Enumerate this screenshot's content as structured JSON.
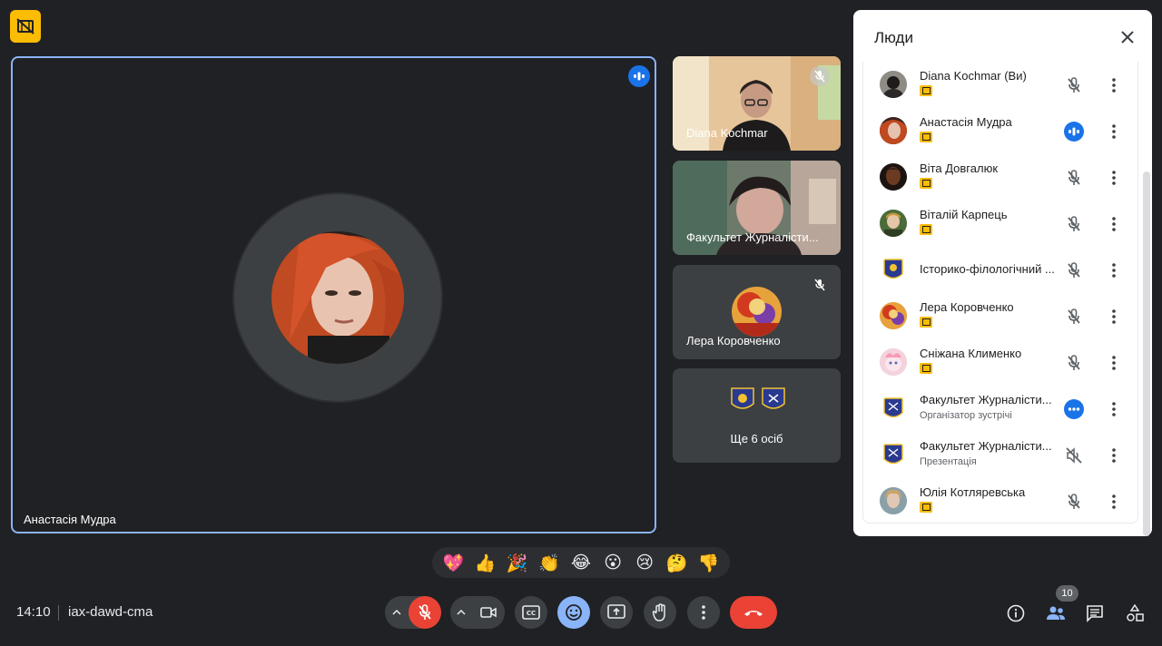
{
  "main": {
    "speaker_name": "Анастасія Мудра"
  },
  "side_tiles": [
    {
      "name": "Diana Kochmar"
    },
    {
      "name": "Факультет Журналісти..."
    },
    {
      "name": "Лера Коровченко"
    },
    {
      "label": "Ще 6 осіб"
    }
  ],
  "people_panel": {
    "title": "Люди",
    "participants": [
      {
        "name": "Diana Kochmar (Ви)",
        "subtitle": "",
        "status": "mic-off"
      },
      {
        "name": "Анастасія Мудра",
        "subtitle": "",
        "status": "speaking"
      },
      {
        "name": "Віта Довгалюк",
        "subtitle": "",
        "status": "mic-off"
      },
      {
        "name": "Віталій Карпець",
        "subtitle": "",
        "status": "mic-off"
      },
      {
        "name": "Історико-філологічний ...",
        "subtitle": "",
        "status": "mic-off"
      },
      {
        "name": "Лера Коровченко",
        "subtitle": "",
        "status": "mic-off"
      },
      {
        "name": "Сніжана Клименко",
        "subtitle": "",
        "status": "mic-off"
      },
      {
        "name": "Факультет Журналісти...",
        "subtitle": "Організатор зустрічі",
        "status": "more"
      },
      {
        "name": "Факультет Журналісти...",
        "subtitle": "Презентація",
        "status": "volume-off"
      },
      {
        "name": "Юлія Котляревська",
        "subtitle": "",
        "status": "mic-off"
      }
    ]
  },
  "reactions": [
    "💖",
    "👍",
    "🎉",
    "👏",
    "😂",
    "😮",
    "😢",
    "🤔",
    "👎"
  ],
  "bottom_bar": {
    "time": "14:10",
    "meeting_code": "iax-dawd-cma",
    "people_count": "10"
  },
  "colors": {
    "background": "#202124",
    "accent_blue": "#8ab4f8",
    "end_call_red": "#ea4335",
    "badge_yellow": "#fbbc04"
  }
}
